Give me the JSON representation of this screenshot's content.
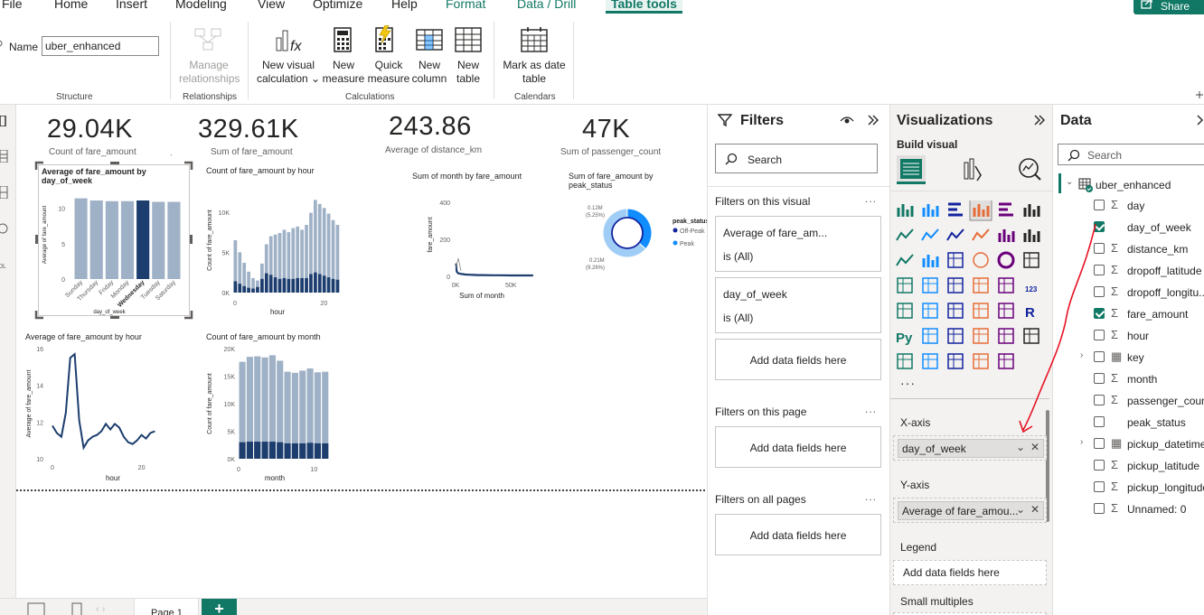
{
  "menu": {
    "items": [
      "File",
      "Home",
      "Insert",
      "Modeling",
      "View",
      "Optimize",
      "Help"
    ],
    "context_items": [
      "Format",
      "Data / Drill"
    ],
    "active": "Table tools",
    "share": "Share"
  },
  "ribbon": {
    "name_label": "Name",
    "name_value": "uber_enhanced",
    "structure_label": "Structure",
    "manage_relationships": [
      "Manage",
      "relationships"
    ],
    "relationships_label": "Relationships",
    "new_visual_calc": [
      "New visual",
      "calculation"
    ],
    "new_measure": [
      "New",
      "measure"
    ],
    "quick_measure": [
      "Quick",
      "measure"
    ],
    "new_column": [
      "New",
      "column"
    ],
    "new_table": [
      "New",
      "table"
    ],
    "calculations_label": "Calculations",
    "mark_date_table": [
      "Mark as date",
      "table"
    ],
    "calendars_label": "Calendars"
  },
  "kpis": [
    {
      "value": "29.04K",
      "label": "Count of fare_amount"
    },
    {
      "value": "329.61K",
      "label": "Sum of fare_amount"
    },
    {
      "value": "243.86",
      "label": "Average of distance_km"
    },
    {
      "value": "47K",
      "label": "Sum of passenger_count"
    }
  ],
  "chart_data": [
    {
      "type": "bar",
      "title": "Average of fare_amount by day_of_week",
      "title_lines": [
        "Average of fare_amount by",
        "day_of_week"
      ],
      "xlabel": "day_of_week",
      "ylabel": "Average of fare_amount",
      "categories": [
        "Sunday",
        "Thursday",
        "Friday",
        "Monday",
        "Wednesday",
        "Tuesday",
        "Saturday"
      ],
      "values": [
        11.4,
        11.1,
        11.0,
        11.0,
        11.1,
        10.9,
        10.9
      ],
      "highlight": "Wednesday",
      "yticks": [
        "10",
        "5",
        "0"
      ],
      "ylim": [
        0,
        12.5
      ]
    },
    {
      "type": "bar",
      "title": "Count of fare_amount by hour",
      "xlabel": "hour",
      "ylabel": "Count of fare_amount",
      "yticks": [
        "10K",
        "5K",
        "0K"
      ],
      "xticks": [
        "0",
        "20"
      ],
      "x": [
        0,
        1,
        2,
        3,
        4,
        5,
        6,
        7,
        8,
        9,
        10,
        11,
        12,
        13,
        14,
        15,
        16,
        17,
        18,
        19,
        20,
        21,
        22,
        23
      ],
      "series": [
        {
          "values": [
            6500,
            5000,
            3700,
            2600,
            1800,
            1500,
            3600,
            6000,
            7000,
            7200,
            7400,
            7800,
            7500,
            8000,
            8200,
            7800,
            8400,
            9900,
            11500,
            11000,
            10500,
            9800,
            9000,
            8400
          ]
        },
        {
          "values": [
            1400,
            1100,
            800,
            600,
            500,
            700,
            1700,
            2400,
            2200,
            1900,
            1700,
            1800,
            1700,
            1700,
            1800,
            1800,
            1800,
            2300,
            2500,
            2300,
            2100,
            1900,
            1700,
            1600
          ]
        }
      ],
      "ylim": [
        0,
        13000
      ]
    },
    {
      "type": "scatter",
      "title": "Sum of month by fare_amount",
      "xlabel": "Sum of month",
      "ylabel": "fare_amount",
      "yticks": [
        "400",
        "200",
        "0"
      ],
      "xticks": [
        "0K",
        "50K"
      ],
      "ylim": [
        0,
        450
      ],
      "xlim": [
        0,
        80000
      ]
    },
    {
      "type": "pie",
      "title": "Sum of fare_amount by peak_status",
      "title_lines": [
        "Sum of fare_amount by",
        "peak_status"
      ],
      "legend_title": "peak_status",
      "slices": [
        {
          "name": "Off-Peak",
          "value": 0.21,
          "label": "0.21M",
          "pct": "(9.26%)",
          "color": "#12239e"
        },
        {
          "name": "Peak",
          "value": 0.12,
          "label": "0.12M",
          "pct": "(5.25%)",
          "color": "#118dff"
        }
      ]
    },
    {
      "type": "line",
      "title": "Average of fare_amount by hour",
      "xlabel": "hour",
      "ylabel": "Average of fare_amount",
      "yticks": [
        "16",
        "14",
        "12",
        "10"
      ],
      "xticks": [
        "0",
        "20"
      ],
      "x": [
        0,
        1,
        2,
        3,
        4,
        5,
        6,
        7,
        8,
        9,
        10,
        11,
        12,
        13,
        14,
        15,
        16,
        17,
        18,
        19,
        20,
        21,
        22,
        23
      ],
      "values": [
        11.8,
        11.4,
        11.2,
        12.5,
        15.5,
        15.7,
        12.1,
        10.6,
        11.0,
        11.2,
        11.3,
        11.5,
        11.9,
        11.6,
        11.9,
        11.7,
        11.2,
        10.9,
        10.8,
        11.0,
        11.3,
        11.1,
        11.4,
        11.5
      ],
      "ylim": [
        10,
        16
      ]
    },
    {
      "type": "bar",
      "title": "Count of fare_amount by month",
      "xlabel": "month",
      "ylabel": "Count of fare_amount",
      "yticks": [
        "20K",
        "15K",
        "10K",
        "5K",
        "0K"
      ],
      "xticks": [
        "0",
        "10"
      ],
      "x": [
        1,
        2,
        3,
        4,
        5,
        6,
        7,
        8,
        9,
        10,
        11,
        12
      ],
      "series": [
        {
          "values": [
            17600,
            18500,
            18600,
            18400,
            18800,
            17800,
            15800,
            15600,
            16000,
            16400,
            15700,
            15800
          ]
        },
        {
          "values": [
            3000,
            3100,
            3100,
            3100,
            3100,
            3000,
            2800,
            2800,
            2800,
            2900,
            2800,
            2800
          ]
        }
      ],
      "ylim": [
        0,
        20000
      ]
    }
  ],
  "filters": {
    "title": "Filters",
    "search": "Search",
    "on_visual": "Filters on this visual",
    "card1_title": "Average of fare_am...",
    "card1_value": "is (All)",
    "card2_title": "day_of_week",
    "card2_value": "is (All)",
    "add": "Add data fields here",
    "on_page": "Filters on this page",
    "on_all": "Filters on all pages"
  },
  "viz": {
    "title": "Visualizations",
    "build": "Build visual",
    "xaxis": "X-axis",
    "xaxis_field": "day_of_week",
    "yaxis": "Y-axis",
    "yaxis_field": "Average of fare_amou...",
    "legend": "Legend",
    "legend_add": "Add data fields here",
    "small_multiples": "Small multiples"
  },
  "data": {
    "title": "Data",
    "search": "Search",
    "table": "uber_enhanced",
    "fields": [
      {
        "name": "day",
        "sigma": true,
        "checked": false,
        "expand": false
      },
      {
        "name": "day_of_week",
        "sigma": false,
        "checked": true,
        "expand": false
      },
      {
        "name": "distance_km",
        "sigma": true,
        "checked": false,
        "expand": false
      },
      {
        "name": "dropoff_latitude",
        "sigma": true,
        "checked": false,
        "expand": false
      },
      {
        "name": "dropoff_longitu...",
        "sigma": true,
        "checked": false,
        "expand": false
      },
      {
        "name": "fare_amount",
        "sigma": true,
        "checked": true,
        "expand": false
      },
      {
        "name": "hour",
        "sigma": true,
        "checked": false,
        "expand": false
      },
      {
        "name": "key",
        "sigma": false,
        "checked": false,
        "expand": true
      },
      {
        "name": "month",
        "sigma": true,
        "checked": false,
        "expand": false
      },
      {
        "name": "passenger_count",
        "sigma": true,
        "checked": false,
        "expand": false
      },
      {
        "name": "peak_status",
        "sigma": false,
        "checked": false,
        "expand": false
      },
      {
        "name": "pickup_datetime",
        "sigma": false,
        "checked": false,
        "expand": true
      },
      {
        "name": "pickup_latitude",
        "sigma": true,
        "checked": false,
        "expand": false
      },
      {
        "name": "pickup_longitude",
        "sigma": true,
        "checked": false,
        "expand": false
      },
      {
        "name": "Unnamed: 0",
        "sigma": true,
        "checked": false,
        "expand": false
      }
    ]
  },
  "pages": {
    "tab": "Page 1",
    "add": "+"
  },
  "colors": {
    "accent": "#117865",
    "bar_light": "#9fb1c6",
    "bar_dark": "#1c3d6e",
    "line": "#1c3d6e"
  }
}
